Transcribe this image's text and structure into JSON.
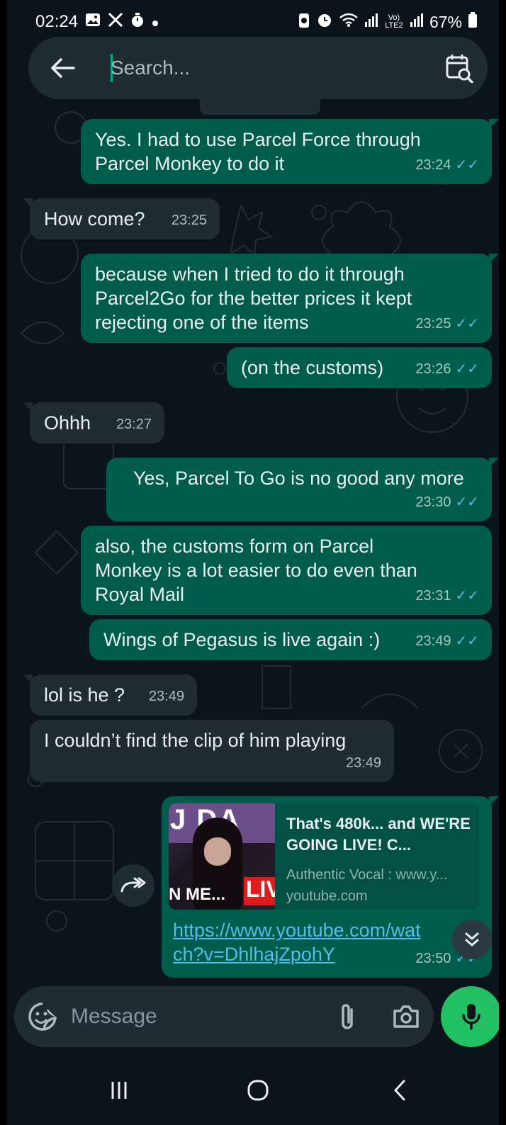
{
  "status_bar": {
    "time": "02:24",
    "battery": "67%",
    "network": "Vo) LTE2",
    "icons": [
      "image-icon",
      "x-icon",
      "timer-icon",
      "dot-icon",
      "battery-saver-icon",
      "alarm-icon",
      "wifi-icon",
      "signal-icon",
      "signal-icon",
      "battery-icon"
    ]
  },
  "search": {
    "placeholder": "Search..."
  },
  "messages": [
    {
      "direction": "out",
      "text": "Yes. I had to use Parcel Force through Parcel Monkey to do it",
      "time": "23:24",
      "read": true
    },
    {
      "direction": "in",
      "text": "How come?",
      "time": "23:25"
    },
    {
      "direction": "out",
      "text": "because when I tried to do it through Parcel2Go for the better prices it kept rejecting one of the items",
      "time": "23:25",
      "read": true
    },
    {
      "direction": "out",
      "text": "(on the customs)",
      "time": "23:26",
      "read": true
    },
    {
      "direction": "in",
      "text": "Ohhh",
      "time": "23:27"
    },
    {
      "direction": "out",
      "text": "Yes, Parcel To Go is no good any more",
      "time": "23:30",
      "read": true
    },
    {
      "direction": "out",
      "text": "also, the customs form on Parcel Monkey is a lot easier to do even than Royal Mail",
      "time": "23:31",
      "read": true
    },
    {
      "direction": "out",
      "text": "Wings of Pegasus is live again :)",
      "time": "23:49",
      "read": true
    },
    {
      "direction": "in",
      "text": "lol is he ?",
      "time": "23:49"
    },
    {
      "direction": "in",
      "text": "I couldn’t find the clip of him playing",
      "time": "23:49"
    }
  ],
  "link_message": {
    "preview_title": "That's 480k... and WE'RE GOING LIVE! C...",
    "preview_desc": "Authentic Vocal : www.y...",
    "preview_domain": "youtube.com",
    "thumb_text_top": "J DA",
    "thumb_text_bottom": "N ME...",
    "thumb_live": "LIV",
    "url": "https://www.youtube.com/watch?v=DhlhajZpohY",
    "time": "23:50",
    "read": true
  },
  "composer": {
    "placeholder": "Message"
  },
  "colors": {
    "background": "#0b141a",
    "outgoing_bubble": "#005c4b",
    "incoming_bubble": "#202c33",
    "read_tick": "#53bdeb",
    "mic_button": "#21c063",
    "caret": "#00a884"
  }
}
